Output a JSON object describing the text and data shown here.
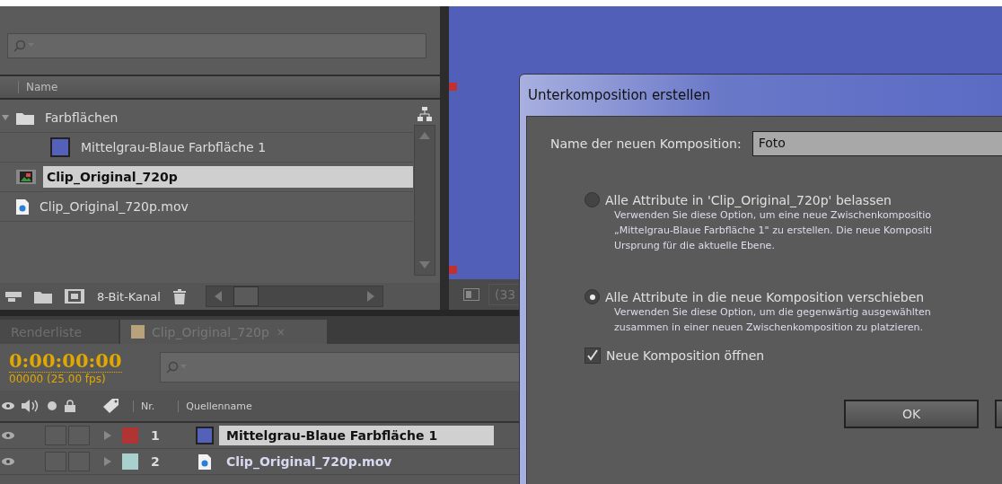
{
  "project": {
    "columns": [
      "Name"
    ],
    "items": [
      {
        "name": "Farbflächen",
        "kind": "folder",
        "expanded": true,
        "selected": false,
        "children": [
          {
            "name": "Mittelgrau-Blaue Farbfläche 1",
            "kind": "solid",
            "selected": false
          }
        ]
      },
      {
        "name": "Clip_Original_720p",
        "kind": "composition",
        "selected": true
      },
      {
        "name": "Clip_Original_720p.mov",
        "kind": "footage",
        "selected": false
      }
    ],
    "bit_depth": "8-Bit-Kanal"
  },
  "viewer": {
    "zoom": "(33"
  },
  "timeline": {
    "tabs": [
      {
        "label": "Renderliste",
        "selected": false
      },
      {
        "label": "Clip_Original_720p",
        "selected": true,
        "close": "×"
      }
    ],
    "timecode": "0:00:00:00",
    "frames": "00000 (25.00 fps)",
    "columns": [
      "Nr.",
      "Quellenname"
    ],
    "layers": [
      {
        "number": "1",
        "name": "Mittelgrau-Blaue Farbfläche 1",
        "kind": "solid",
        "color": "#b03434",
        "selected": true
      },
      {
        "number": "2",
        "name": "Clip_Original_720p.mov",
        "kind": "footage",
        "color": "#a8d0cc",
        "selected": false
      }
    ]
  },
  "dialog": {
    "title": "Unterkomposition erstellen",
    "name_label": "Name der neuen Komposition:",
    "name_value": "Foto",
    "options": [
      {
        "label": "Alle Attribute in 'Clip_Original_720p' belassen",
        "selected": false,
        "description": [
          "Verwenden Sie diese Option, um eine neue Zwischenkompositio",
          "„Mittelgrau-Blaue Farbfläche 1\" zu erstellen. Die neue Kompositi",
          "Ursprung für die aktuelle Ebene."
        ]
      },
      {
        "label": "Alle Attribute in die neue Komposition verschieben",
        "selected": true,
        "description": [
          "Verwenden Sie diese Option, um die gegenwärtig ausgewählten",
          "zusammen in einer neuen Zwischenkomposition zu platzieren."
        ]
      }
    ],
    "checkbox": {
      "label": "Neue Komposition öffnen",
      "checked": true
    },
    "buttons": [
      "OK"
    ]
  }
}
